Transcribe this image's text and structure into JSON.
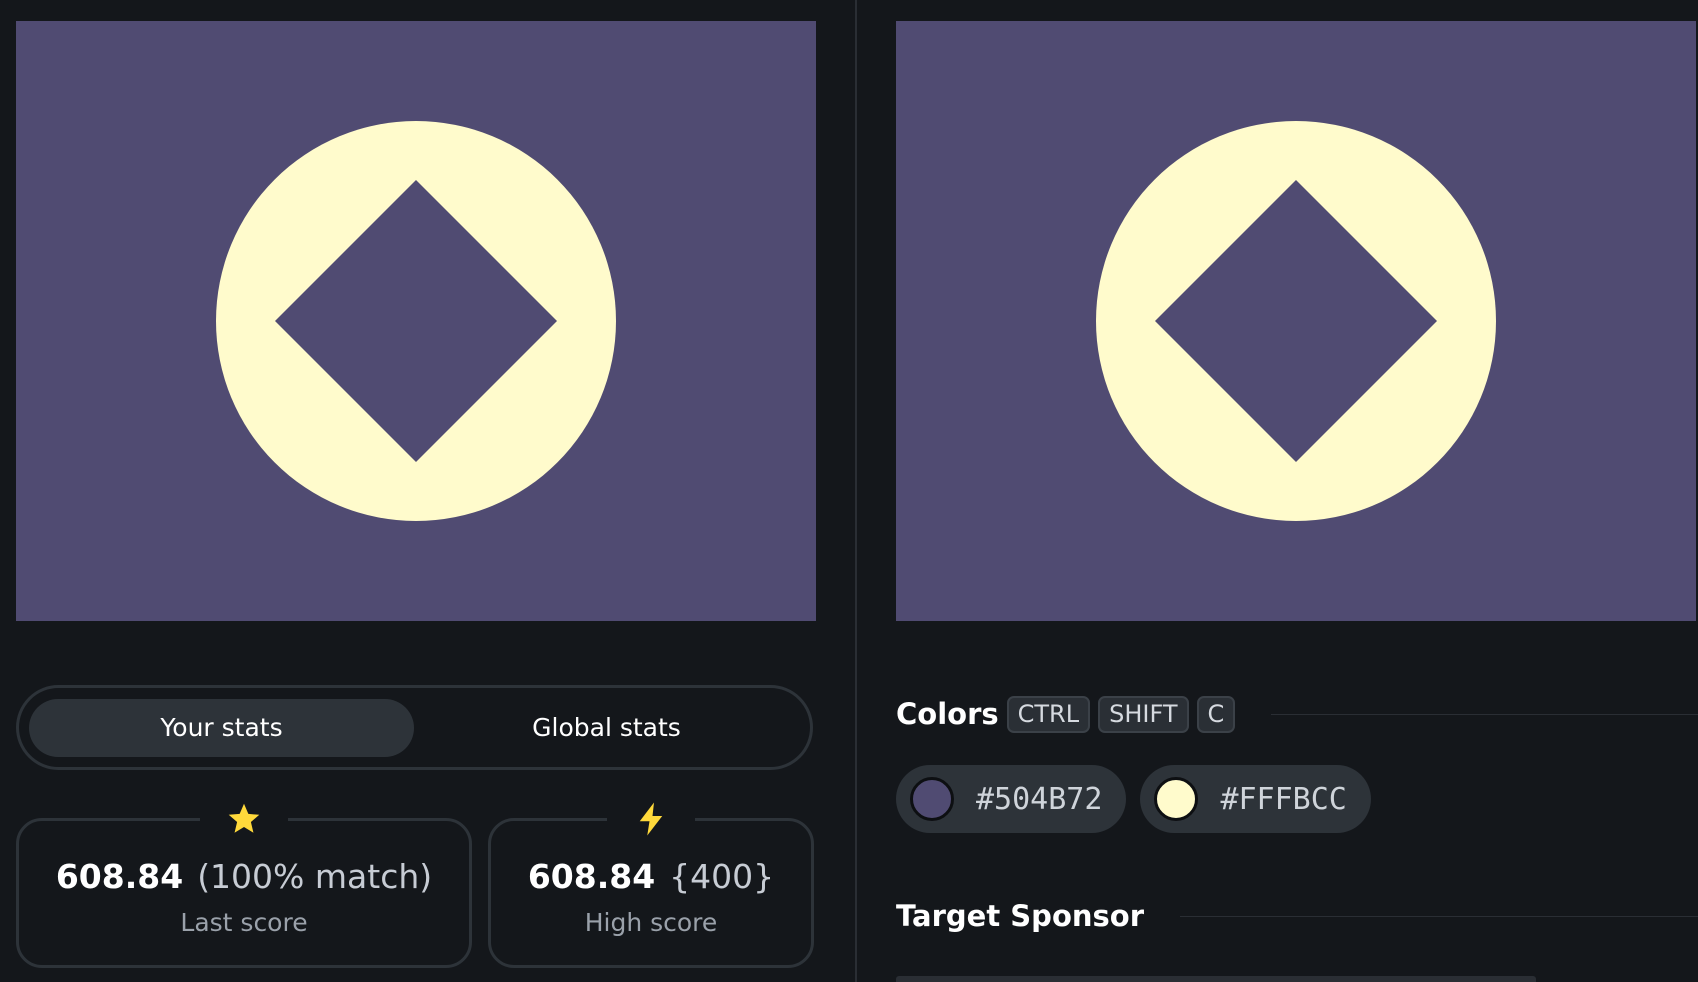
{
  "output": {
    "background": "#504B72",
    "shapes": [
      "circle",
      "diamond"
    ]
  },
  "target": {
    "background": "#504B72",
    "shapes": [
      "circle",
      "diamond"
    ]
  },
  "stats_toggle": {
    "your_stats": "Your stats",
    "global_stats": "Global stats",
    "active": "your_stats"
  },
  "last_score": {
    "icon": "star-icon",
    "value": "608.84",
    "extra": "(100% match)",
    "label": "Last score"
  },
  "high_score": {
    "icon": "lightning-icon",
    "value": "608.84",
    "extra": "{400}",
    "label": "High score"
  },
  "colors": {
    "title": "Colors",
    "shortcut": [
      "CTRL",
      "SHIFT",
      "C"
    ],
    "swatches": [
      {
        "hex": "#504B72",
        "color": "#504B72"
      },
      {
        "hex": "#FFFBCC",
        "color": "#FFFBCC"
      }
    ]
  },
  "sponsor": {
    "title": "Target Sponsor"
  },
  "accent": {
    "icon_yellow": "#FFD93B",
    "panel": "#2D3339",
    "page_bg": "#14171B"
  }
}
